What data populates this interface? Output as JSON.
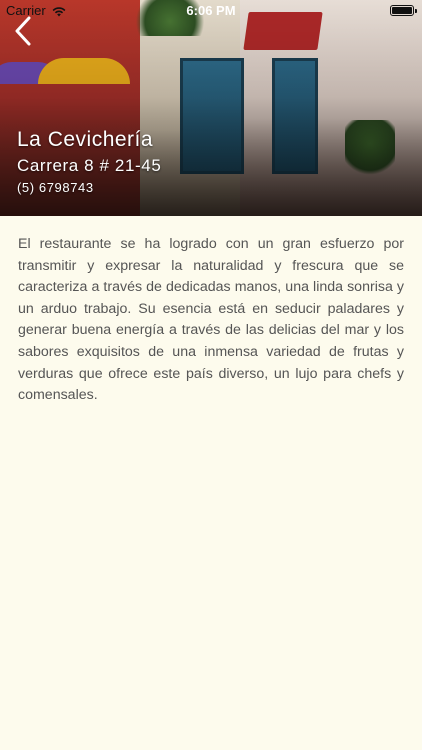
{
  "status_bar": {
    "carrier": "Carrier",
    "time": "6:06 PM",
    "wifi_icon": "wifi-icon",
    "battery_icon": "battery-icon",
    "battery_level": 1.0
  },
  "nav": {
    "back_icon": "chevron-left-icon"
  },
  "restaurant": {
    "name": "La Cevichería",
    "address": "Carrera 8 # 21-45",
    "phone": "(5) 6798743",
    "description": "El restaurante se ha logrado con un gran esfuerzo por transmitir y expresar la naturalidad y frescura que se caracteriza a través de dedicadas manos, una linda sonrisa y un arduo trabajo. Su esencia está en seducir paladares y generar buena energía a través de las delicias del mar y los sabores exquisitos de una inmensa variedad de frutas y verduras que ofrece este país diverso, un lujo para chefs y comensales."
  },
  "colors": {
    "background": "#fdfbed",
    "text": "#555555",
    "header_text": "#ffffff"
  }
}
